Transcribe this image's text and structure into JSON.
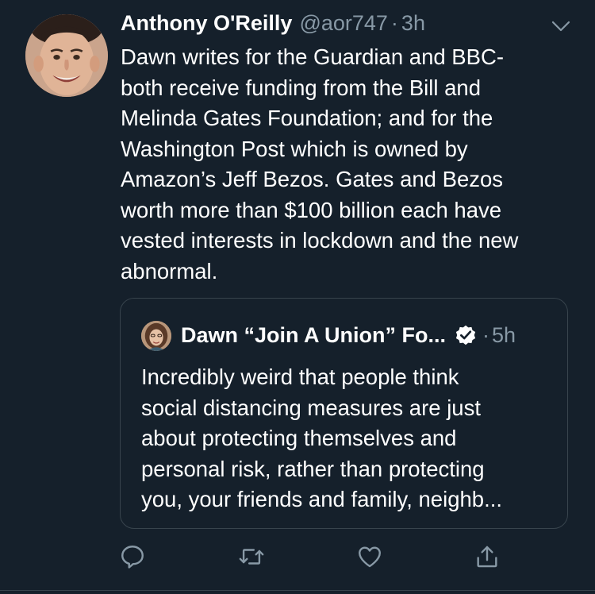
{
  "tweet": {
    "author_name": "Anthony O'Reilly",
    "handle": "@aor747",
    "separator": "·",
    "time": "3h",
    "text": "Dawn writes for the Guardian and BBC-\nboth receive funding from the Bill and\nMelinda Gates Foundation; and for the\nWashington Post which is owned by\nAmazon’s Jeff Bezos. Gates and Bezos\nworth more than $100 billion each have\nvested interests in lockdown and the new\nabnormal.",
    "avatar_icon": "person-avatar",
    "menu_icon": "chevron-down-icon"
  },
  "quoted": {
    "author_name": "Dawn “Join A Union” Fo...",
    "verified_icon": "verified-badge-icon",
    "separator": "·",
    "time": "5h",
    "text": "Incredibly weird that people think\nsocial distancing measures are just\nabout protecting themselves and\npersonal risk, rather than protecting\nyou, your friends and family, neighb...",
    "avatar_icon": "person-avatar"
  },
  "actions": [
    {
      "name": "reply",
      "icon": "reply-icon"
    },
    {
      "name": "retweet",
      "icon": "retweet-icon"
    },
    {
      "name": "like",
      "icon": "heart-icon"
    },
    {
      "name": "share",
      "icon": "share-icon"
    }
  ],
  "colors": {
    "background": "#15202b",
    "text": "#ffffff",
    "secondary": "#8899a6",
    "border": "#38444d"
  }
}
